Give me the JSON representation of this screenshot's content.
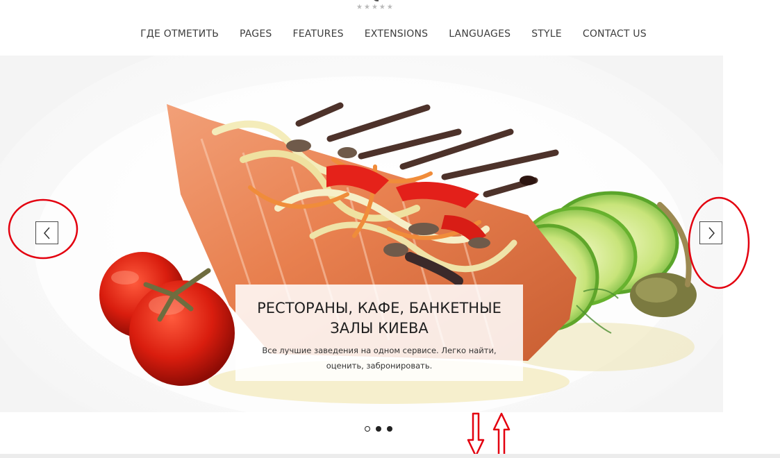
{
  "header": {
    "rating_stars": [
      "★",
      "★",
      "★",
      "★",
      "★"
    ]
  },
  "nav": {
    "items": [
      "ГДЕ ОТМЕТИТЬ",
      "PAGES",
      "FEATURES",
      "EXTENSIONS",
      "LANGUAGES",
      "STYLE",
      "CONTACT US"
    ]
  },
  "slider": {
    "prev_icon": "chevron-left-icon",
    "next_icon": "chevron-right-icon",
    "caption_title": "РЕСТОРАНЫ, КАФЕ, БАНКЕТНЫЕ ЗАЛЫ КИЕВА",
    "caption_text": "Все лучшие заведения на одном сервисе. Легко найти, оценить, забронировать.",
    "slide_count": 3,
    "active_slide": 1
  },
  "colors": {
    "nav_text": "#3d3d3d",
    "annotation": "#e3000f"
  }
}
